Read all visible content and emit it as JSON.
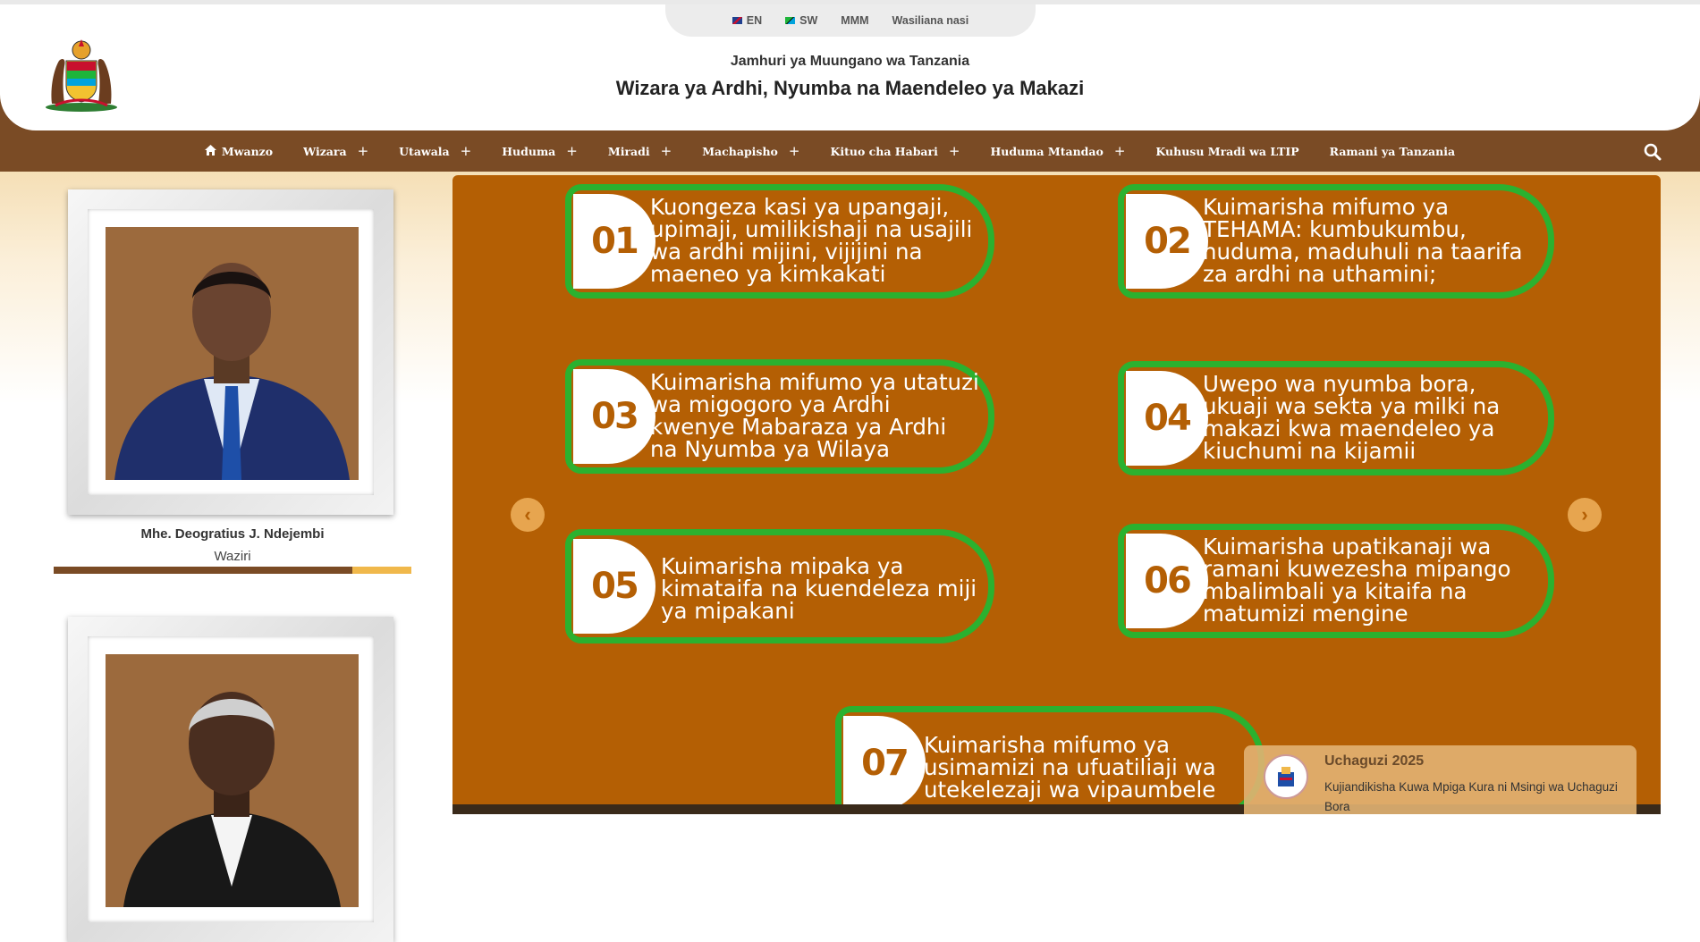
{
  "utility": {
    "lang_en": "EN",
    "lang_sw": "SW",
    "mmm": "MMM",
    "contact": "Wasiliana nasi"
  },
  "header": {
    "subtitle": "Jamhuri ya Muungano wa Tanzania",
    "title": "Wizara ya Ardhi, Nyumba na Maendeleo ya Makazi"
  },
  "nav": {
    "items": [
      {
        "label": "Mwanzo",
        "icon": "home-icon"
      },
      {
        "label": "Wizara",
        "has_submenu": true
      },
      {
        "label": "Utawala",
        "has_submenu": true
      },
      {
        "label": "Huduma",
        "has_submenu": true
      },
      {
        "label": "Miradi",
        "has_submenu": true
      },
      {
        "label": "Machapisho",
        "has_submenu": true
      },
      {
        "label": "Kituo cha Habari",
        "has_submenu": true
      },
      {
        "label": "Huduma Mtandao",
        "has_submenu": true
      },
      {
        "label": "Kuhusu Mradi wa LTIP"
      },
      {
        "label": "Ramani ya Tanzania"
      }
    ],
    "plus": "+",
    "search_icon": "search-icon"
  },
  "leaders": [
    {
      "name": "Mhe. Deogratius J. Ndejembi",
      "role": "Waziri"
    },
    {
      "name": "",
      "role": ""
    }
  ],
  "slider": {
    "items": [
      {
        "num": "01",
        "text": "Kuongeza kasi ya upangaji, upimaji, umilikishaji na usajili wa ardhi mijini, vijijini na maeneo ya kimkakati"
      },
      {
        "num": "02",
        "text": "Kuimarisha mifumo ya TEHAMA: kumbukumbu, huduma, maduhuli na taarifa za ardhi na uthamini;"
      },
      {
        "num": "03",
        "text": "Kuimarisha mifumo ya utatuzi wa migogoro ya Ardhi  kwenye Mabaraza ya Ardhi na Nyumba ya Wilaya"
      },
      {
        "num": "04",
        "text": "Uwepo wa nyumba bora, ukuaji wa sekta ya milki na  makazi kwa maendeleo ya kiuchumi na kijamii"
      },
      {
        "num": "05",
        "text": "Kuimarisha mipaka ya kimataifa na kuendeleza miji ya mipakani"
      },
      {
        "num": "06",
        "text": "Kuimarisha upatikanaji wa ramani kuwezesha  mipango mbalimbali ya kitaifa na matumizi mengine"
      },
      {
        "num": "07",
        "text": "Kuimarisha mifumo ya usimamizi na ufuatiliaji wa utekelezaji wa vipaumbele"
      }
    ],
    "prev": "‹",
    "next": "›"
  },
  "toast": {
    "title": "Uchaguzi 2025",
    "text": "Kujiandikisha Kuwa Mpiga Kura ni Msingi wa Uchaguzi Bora"
  },
  "colors": {
    "brown": "#7a4b25",
    "slider_bg": "#b45f04",
    "green": "#2bb12f",
    "gold": "#f0b84b"
  }
}
